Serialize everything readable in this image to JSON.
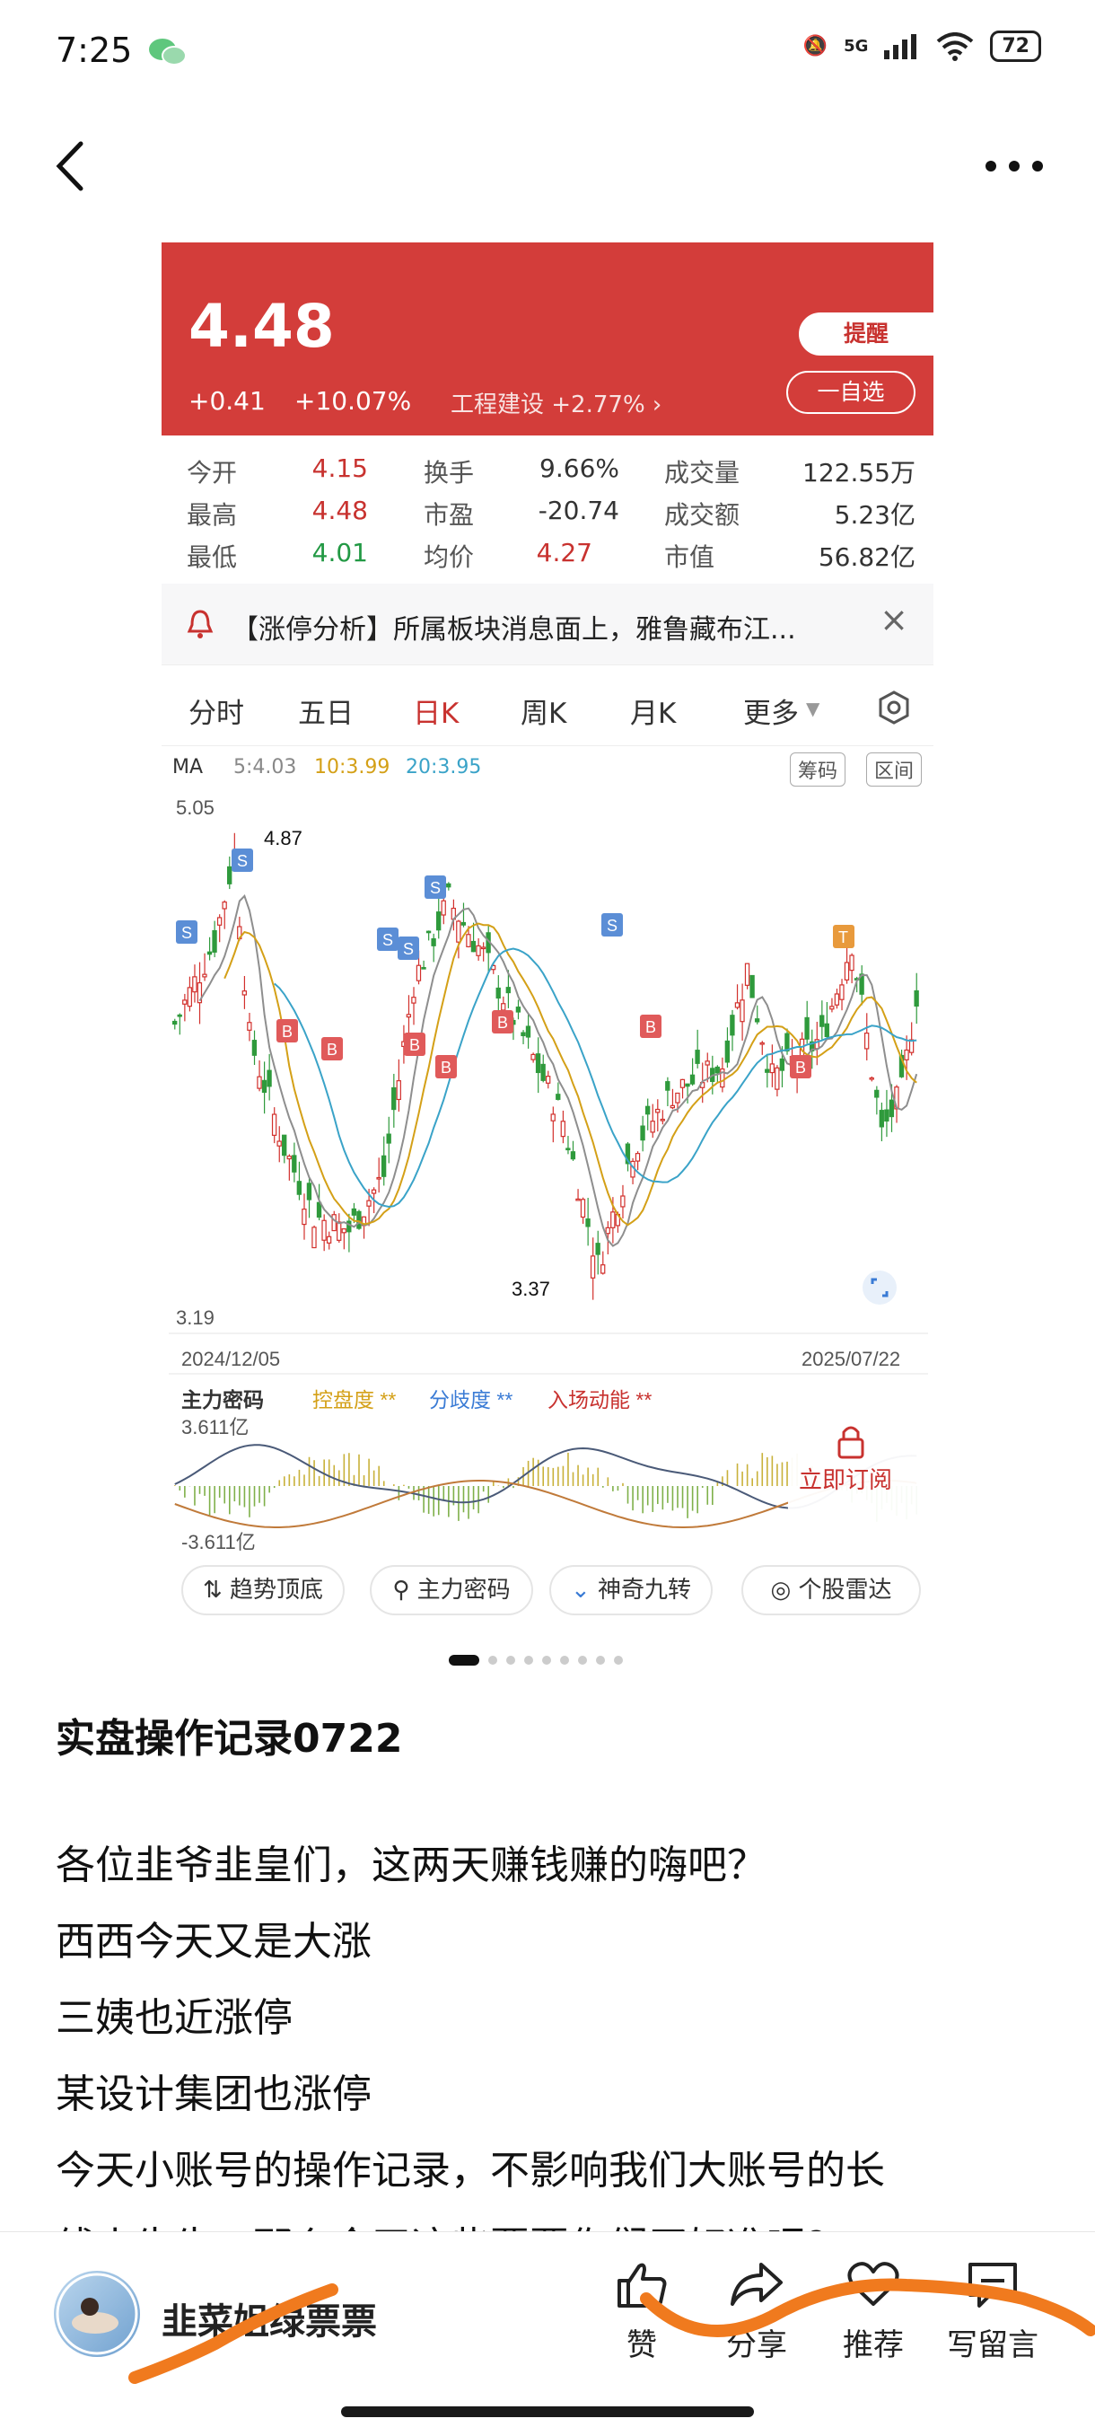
{
  "status_bar": {
    "time": "7:25",
    "network": "5G",
    "battery": "72"
  },
  "stock": {
    "price": "4.48",
    "change_abs": "+0.41",
    "change_pct": "+10.07%",
    "sector": "工程建设 +2.77% ›",
    "remind_button": "提醒",
    "watch_button": "一自选",
    "stats": {
      "open_label": "今开",
      "open_value": "4.15",
      "high_label": "最高",
      "high_value": "4.48",
      "low_label": "最低",
      "low_value": "4.01",
      "turnover_label": "换手",
      "turnover_value": "9.66%",
      "pe_label": "市盈",
      "pe_value": "-20.74",
      "avg_label": "均价",
      "avg_value": "4.27",
      "volume_label": "成交量",
      "volume_value": "122.55万",
      "amount_label": "成交额",
      "amount_value": "5.23亿",
      "mcap_label": "市值",
      "mcap_value": "56.82亿"
    },
    "alert": "【涨停分析】所属板块消息面上，雅鲁藏布江...",
    "tabs": [
      "分时",
      "五日",
      "日K",
      "周K",
      "月K",
      "更多"
    ],
    "ma": {
      "label": "MA",
      "ma5": "5:4.03",
      "ma10": "10:3.99",
      "ma20": "20:3.95"
    },
    "chips": [
      "筹码",
      "区间"
    ],
    "indicator": {
      "name": "主力密码",
      "items": [
        "控盘度 **",
        "分歧度 **",
        "入场动能 **"
      ],
      "top": "3.611亿",
      "bottom": "-3.611亿",
      "subscribe": "立即订阅"
    },
    "tools": [
      "趋势顶底",
      "主力密码",
      "神奇九转",
      "个股雷达"
    ]
  },
  "chart_data": {
    "type": "candlestick",
    "y_top_label": "5.05",
    "y_bottom_label": "3.19",
    "x_start": "2024/12/05",
    "x_end": "2025/07/22",
    "annotations": [
      "4.87",
      "3.37"
    ],
    "markers": [
      "S",
      "S",
      "S",
      "S",
      "S",
      "S",
      "T",
      "B",
      "B",
      "B",
      "B",
      "B",
      "B",
      "B"
    ]
  },
  "post": {
    "title": "实盘操作记录0722",
    "lines": [
      "各位韭爷韭皇们，这两天赚钱赚的嗨吧？",
      "西西今天又是大涨",
      "三姨也近涨停",
      "某设计集团也涨停",
      "今天小账号的操作记录，不影响我们大账号的长",
      "线小牛牛，那么今天这些票票你们买好准呢？"
    ]
  },
  "bottom_bar": {
    "author": "韭菜姐绿票票",
    "actions": [
      "赞",
      "分享",
      "推荐",
      "写留言"
    ]
  }
}
